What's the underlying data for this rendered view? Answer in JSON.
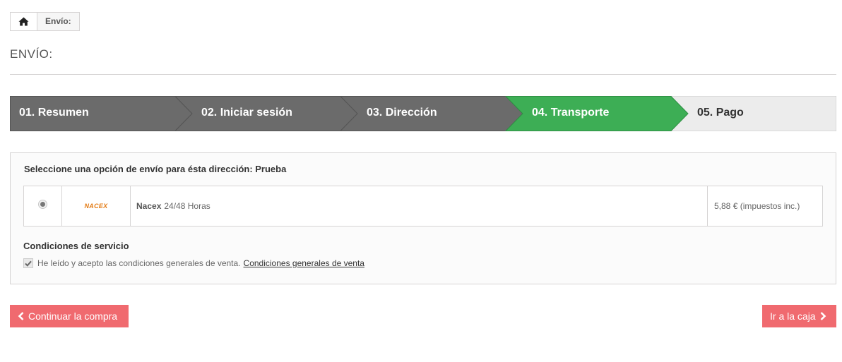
{
  "breadcrumb": {
    "home_icon": "home-icon",
    "current": "Envío:"
  },
  "page": {
    "title": "ENVÍO:"
  },
  "steps": [
    {
      "label": "01. Resumen",
      "state": "done"
    },
    {
      "label": "02. Iniciar sesión",
      "state": "done"
    },
    {
      "label": "03. Dirección",
      "state": "done"
    },
    {
      "label": "04. Transporte",
      "state": "current"
    },
    {
      "label": "05. Pago",
      "state": "todo"
    }
  ],
  "colors": {
    "step_done": "#6b6b6b",
    "step_current": "#3dae55",
    "step_todo": "#ececec",
    "button": "#f06a6f"
  },
  "shipping": {
    "heading": "Seleccione una opción de envío para ésta dirección: Prueba",
    "carrier": {
      "logo_text": "NACEX",
      "name": "Nacex",
      "delay": "24/48 Horas",
      "price": "5,88 € (impuestos inc.)",
      "selected": true
    },
    "terms": {
      "title": "Condiciones de servicio",
      "text": "He leído y acepto las condiciones generales de venta.",
      "link": "Condiciones generales de venta",
      "checked": true
    }
  },
  "buttons": {
    "back": "Continuar la compra",
    "next": "Ir a la caja"
  }
}
